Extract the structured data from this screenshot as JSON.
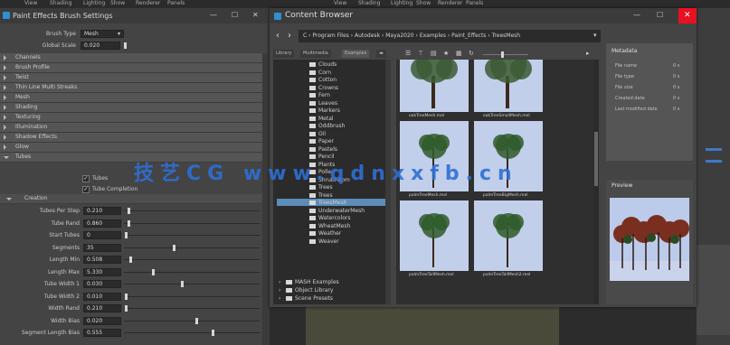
{
  "app_menu": [
    "View",
    "Shading",
    "Lighting",
    "Show",
    "Renderer",
    "Panels"
  ],
  "app_menu_right": [
    "View",
    "Shading",
    "Lighting",
    "Show",
    "Renderer",
    "Panels"
  ],
  "left_panel": {
    "title": "Paint Effects Brush Settings",
    "brush_type_label": "Brush Type",
    "brush_type_value": "Mesh",
    "global_scale_label": "Global Scale",
    "global_scale_value": "0.020",
    "sections": [
      "Channels",
      "Brush Profile",
      "Twist",
      "Thin Line Multi Streaks",
      "Mesh",
      "Shading",
      "Texturing",
      "Illumination",
      "Shadow Effects",
      "Glow",
      "Tubes"
    ],
    "tubes_checks": [
      "Tubes",
      "Tube Completion"
    ],
    "creation_label": "Creation",
    "fields": [
      {
        "label": "Tubes Per Step",
        "value": "0.210",
        "pos": 0.02
      },
      {
        "label": "Tube Rand",
        "value": "0.860",
        "pos": 0.02
      },
      {
        "label": "Start Tubes",
        "value": "0",
        "pos": 0.0
      },
      {
        "label": "Segments",
        "value": "35",
        "pos": 0.35
      },
      {
        "label": "Length Min",
        "value": "0.508",
        "pos": 0.03
      },
      {
        "label": "Length Max",
        "value": "5.330",
        "pos": 0.2
      },
      {
        "label": "Tube Width 1",
        "value": "0.030",
        "pos": 0.41
      },
      {
        "label": "Tube Width 2",
        "value": "0.010",
        "pos": 0.0
      },
      {
        "label": "Width Rand",
        "value": "0.210",
        "pos": 0.0
      },
      {
        "label": "Width Bias",
        "value": "0.020",
        "pos": 0.52
      },
      {
        "label": "Segment Length Bias",
        "value": "0.555",
        "pos": 0.64
      }
    ]
  },
  "content_browser": {
    "title": "Content Browser",
    "path": "C  ›  Program Files  ›  Autodesk  ›  Maya2020  ›  Examples  ›  Paint_Effects  ›  TreesMesh",
    "tabs": [
      "Library",
      "Multimedia",
      "Examples"
    ],
    "tree_items": [
      "Clouds",
      "Corn",
      "Cotton",
      "Crowns",
      "Fern",
      "Leaves",
      "Markers",
      "Metal",
      "Oddbrush",
      "Oil",
      "Paper",
      "Pastels",
      "Pencil",
      "Plants",
      "Pollen",
      "ShrubRoom",
      "Trees",
      "Trees",
      "TreesMesh",
      "UnderwaterMesh",
      "Watercolors",
      "WheatMesh",
      "Weather",
      "Weaver"
    ],
    "tree_selected": "TreesMesh",
    "tree_bottom": [
      "MASH Examples",
      "Object Library",
      "Scene Presets"
    ],
    "thumbnails": [
      {
        "caption": "oakTreeMesh.mel"
      },
      {
        "caption": "oakTreeSmallMesh.mel"
      },
      {
        "caption": "palmTreeMesh.mel"
      },
      {
        "caption": "palmTreeBigMesh.mel"
      },
      {
        "caption": "palmTreeTallMesh.mel"
      },
      {
        "caption": "palmTreeTallMesh2.mel"
      }
    ],
    "metadata_heading": "Metadata",
    "metadata_rows": [
      {
        "label": "File name",
        "value": "0 s"
      },
      {
        "label": "File type",
        "value": "0 s"
      },
      {
        "label": "File size",
        "value": "0 s"
      },
      {
        "label": "Created date",
        "value": "0 s"
      },
      {
        "label": "Last modified date",
        "value": "0 s"
      }
    ],
    "preview_heading": "Preview"
  },
  "watermark": "技艺CG  www.qdnxxfb.cn",
  "colors": {
    "accent": "#5b8db8",
    "close": "#e81123",
    "app_icon": "#2f8fcf"
  }
}
